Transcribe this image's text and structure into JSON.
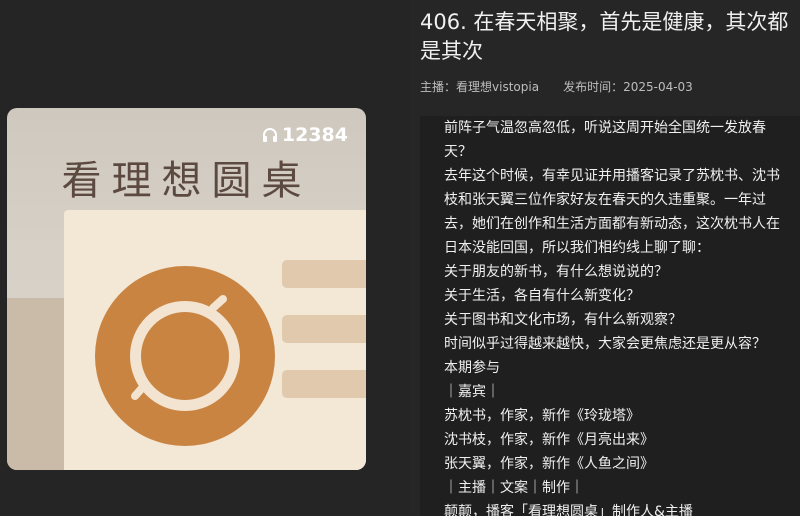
{
  "cover": {
    "listen_count": "12384",
    "title": "看理想圆桌",
    "accent_color": "#c98442"
  },
  "episode": {
    "title": "406. 在春天相聚，首先是健康，其次都是其次",
    "host_label": "主播：",
    "host_name": "看理想vistopia",
    "date_label": "发布时间：",
    "date": "2025-04-03"
  },
  "description": [
    "前阵子气温忽高忽低，听说这周开始全国统一发放春天？",
    "去年这个时候，有幸见证并用播客记录了苏枕书、沈书枝和张天翼三位作家好友在春天的久违重聚。一年过去，她们在创作和生活方面都有新动态，这次枕书人在日本没能回国，所以我们相约线上聊了聊：",
    "关于朋友的新书，有什么想说说的？",
    "关于生活，各自有什么新变化？",
    "关于图书和文化市场，有什么新观察？",
    "时间似乎过得越来越快，大家会更焦虑还是更从容？",
    "本期参与",
    "｜嘉宾｜",
    "苏枕书，作家，新作《玲珑塔》",
    "沈书枝，作家，新作《月亮出来》",
    "张天翼，作家，新作《人鱼之间》",
    "｜主播｜文案｜制作｜",
    "颠颠，播客「看理想圆桌」制作人&主播"
  ]
}
